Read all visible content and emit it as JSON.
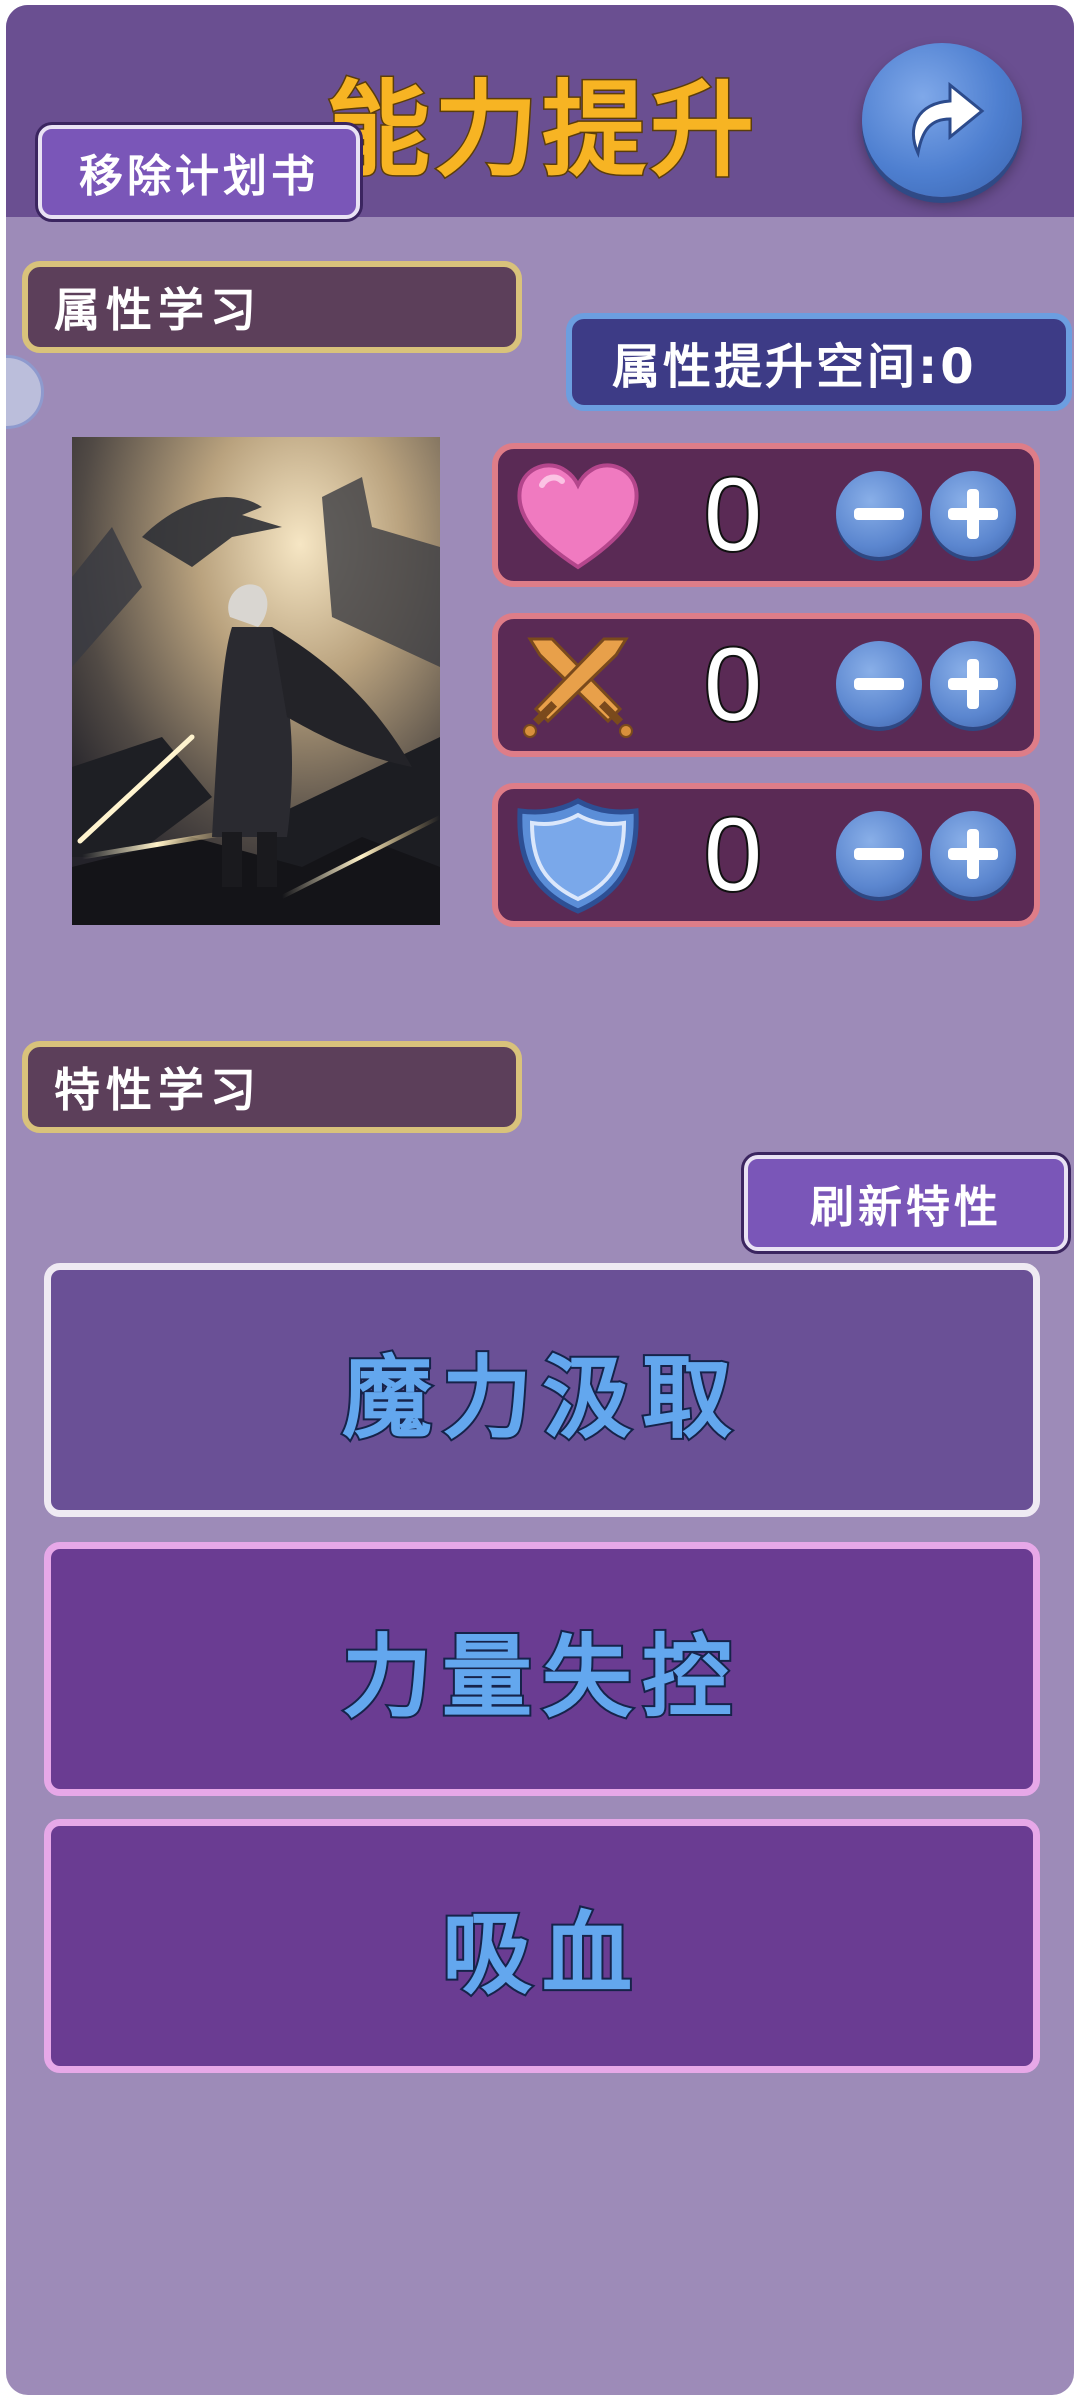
{
  "header": {
    "title": "能力提升",
    "remove_plan_label": "移除计划书",
    "back_icon": "return-arrow-icon"
  },
  "attribute_section": {
    "label": "属性学习",
    "space_label": "属性提升空间:0",
    "stats": [
      {
        "icon": "heart-icon",
        "value": "0"
      },
      {
        "icon": "crossed-swords-icon",
        "value": "0"
      },
      {
        "icon": "shield-icon",
        "value": "0"
      }
    ]
  },
  "trait_section": {
    "label": "特性学习",
    "refresh_label": "刷新特性",
    "traits": [
      {
        "name": "魔力汲取"
      },
      {
        "name": "力量失控"
      },
      {
        "name": "吸血"
      }
    ]
  },
  "colors": {
    "background": "#9d8bb8",
    "header": "#6a4f91",
    "title": "#f7b423",
    "trait_text": "#63a7ee"
  }
}
